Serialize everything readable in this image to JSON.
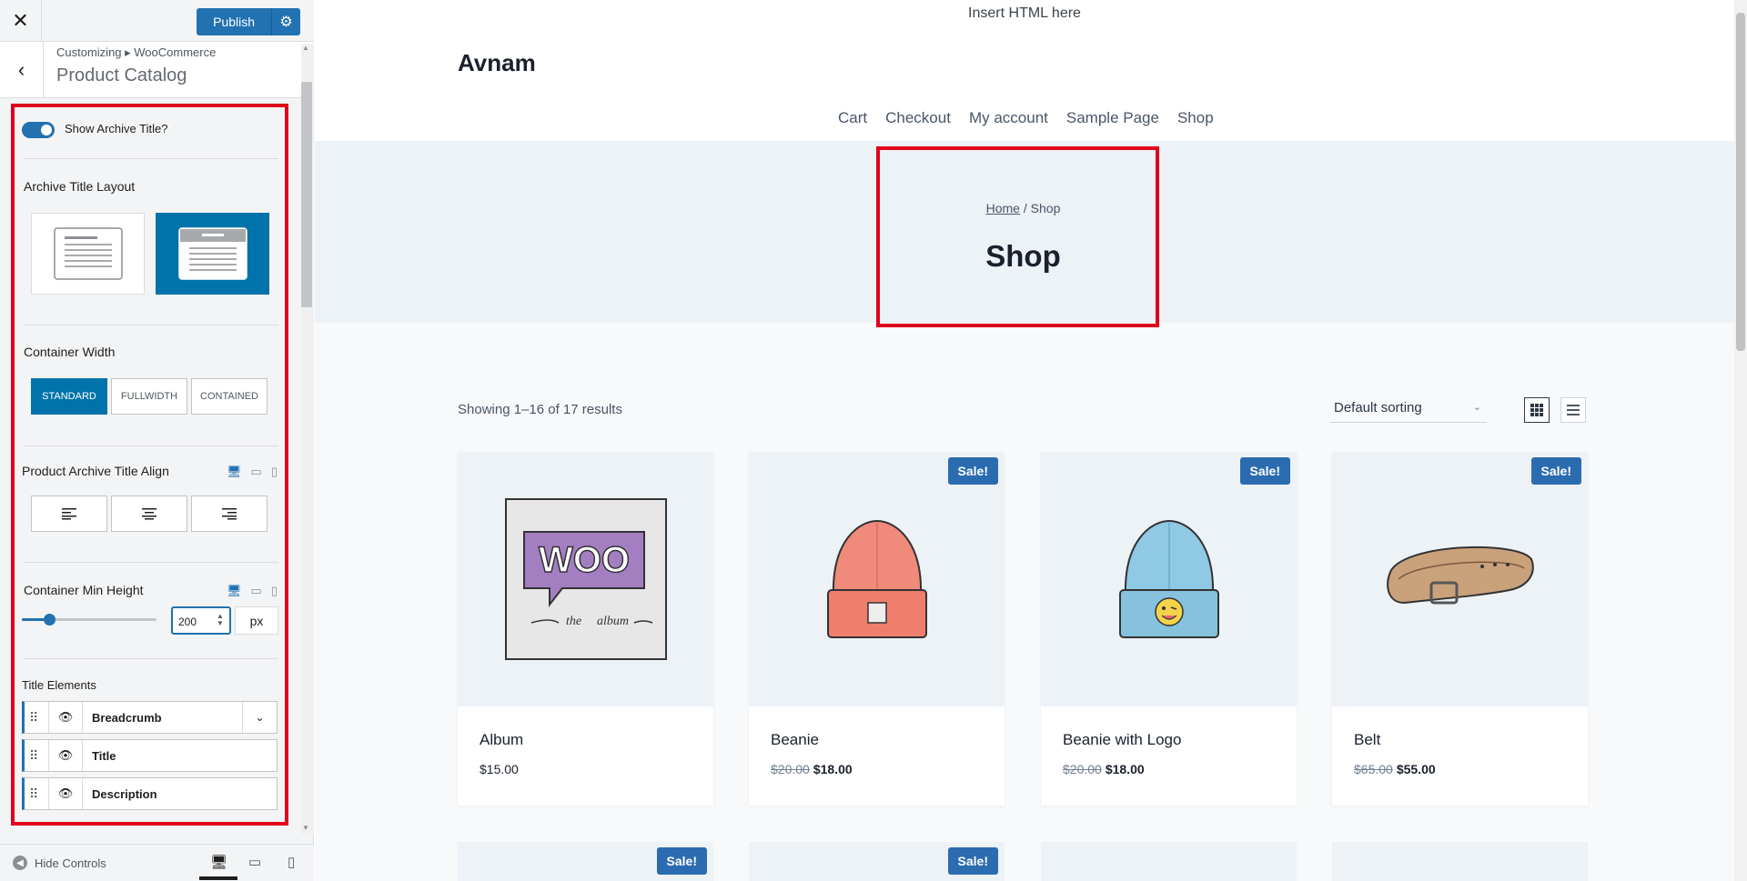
{
  "customizer": {
    "publish_label": "Publish",
    "breadcrumb": "Customizing ▸ WooCommerce",
    "section_title": "Product Catalog",
    "show_archive_title": {
      "label": "Show Archive Title?",
      "enabled": true
    },
    "archive_title_layout": {
      "label": "Archive Title Layout",
      "selected": "above"
    },
    "container_width": {
      "label": "Container Width",
      "options": [
        "STANDARD",
        "FULLWIDTH",
        "CONTAINED"
      ],
      "selected": "STANDARD"
    },
    "title_align": {
      "label": "Product Archive Title Align"
    },
    "min_height": {
      "label": "Container Min Height",
      "value": "200",
      "unit": "px",
      "slider_fraction": 0.2
    },
    "title_elements": {
      "label": "Title Elements",
      "items": [
        {
          "label": "Breadcrumb",
          "has_dropdown": true
        },
        {
          "label": "Title",
          "has_dropdown": false
        },
        {
          "label": "Description",
          "has_dropdown": false
        }
      ]
    },
    "hide_controls_label": "Hide Controls"
  },
  "preview": {
    "insert_html": "Insert HTML here",
    "site_title": "Avnam",
    "nav": [
      "Cart",
      "Checkout",
      "My account",
      "Sample Page",
      "Shop"
    ],
    "breadcrumb_home": "Home",
    "breadcrumb_sep": " / ",
    "breadcrumb_current": "Shop",
    "page_title": "Shop",
    "result_count": "Showing 1–16 of 17 results",
    "sorting": "Default sorting",
    "sale_label": "Sale!",
    "products": [
      {
        "name": "Album",
        "old_price": "",
        "price": "$15.00",
        "sale": false
      },
      {
        "name": "Beanie",
        "old_price": "$20.00",
        "price": "$18.00",
        "sale": true
      },
      {
        "name": "Beanie with Logo",
        "old_price": "$20.00",
        "price": "$18.00",
        "sale": true
      },
      {
        "name": "Belt",
        "old_price": "$65.00",
        "price": "$55.00",
        "sale": true
      }
    ],
    "second_row_sale": [
      true,
      true,
      false,
      false
    ]
  },
  "colors": {
    "accent": "#2271b1",
    "highlight": "#e0001b",
    "sale_badge": "#2b6cb0"
  }
}
